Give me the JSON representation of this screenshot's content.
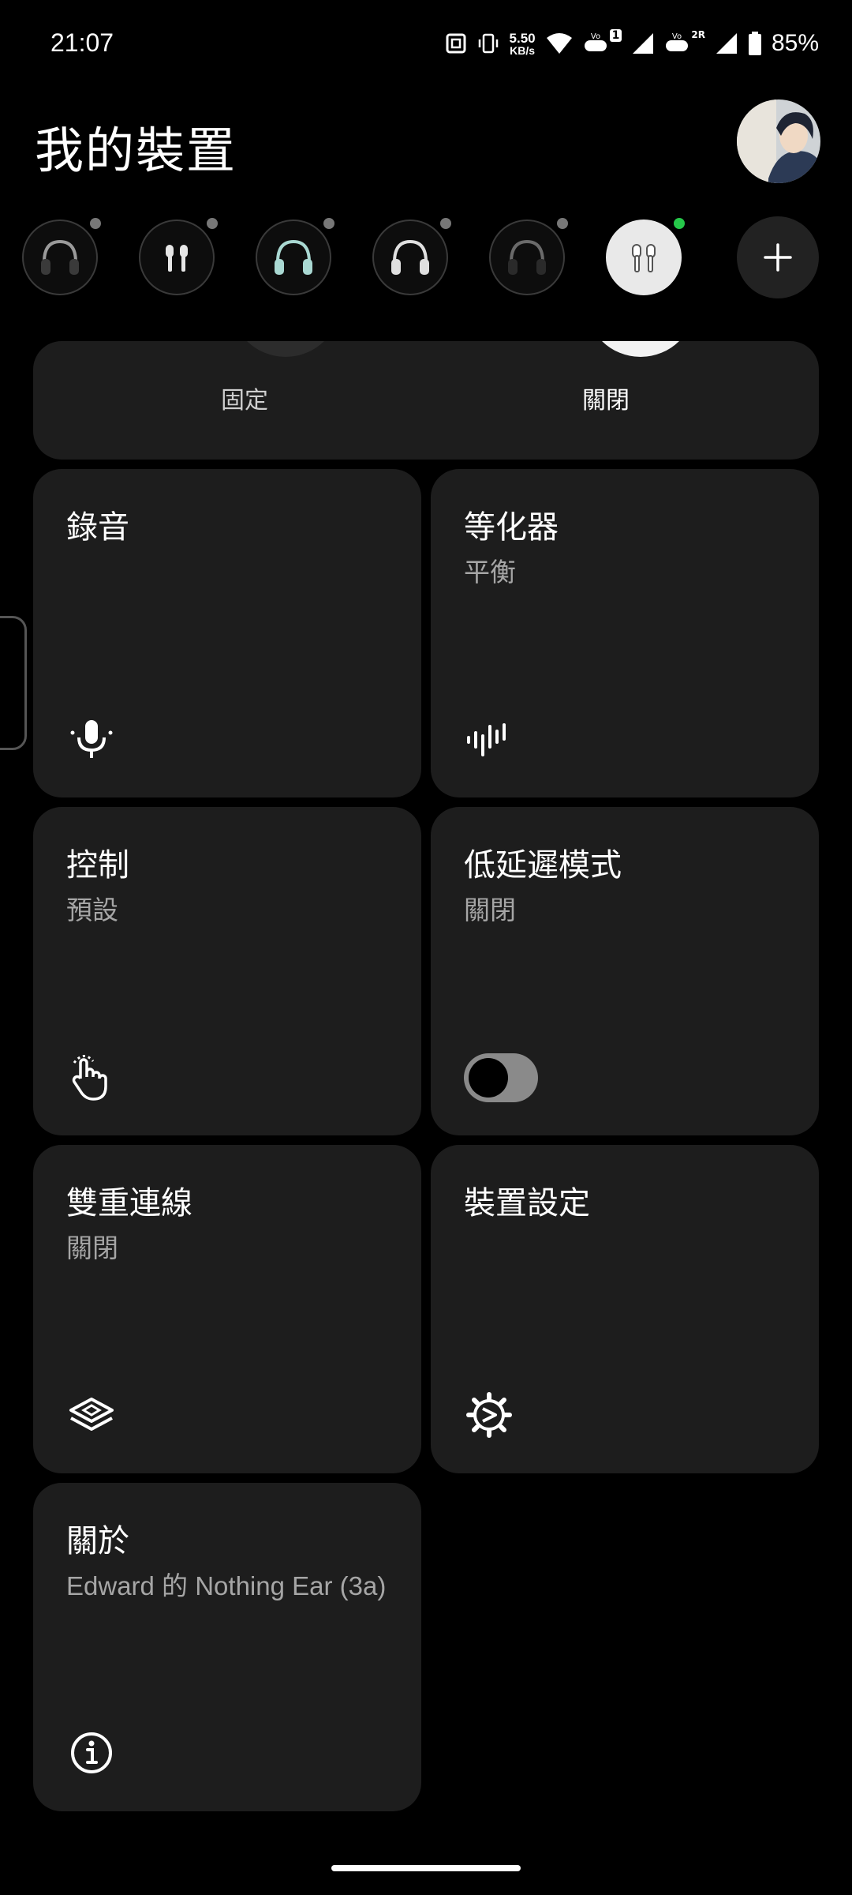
{
  "status_bar": {
    "time": "21:07",
    "speed_value": "5.50",
    "speed_unit": "KB/s",
    "sim1_badge": "1",
    "sim2_badge": "2R",
    "battery": "85%"
  },
  "header": {
    "title": "我的裝置"
  },
  "devices": [
    {
      "icon": "headphones-icon",
      "status": "inactive"
    },
    {
      "icon": "earbuds-icon",
      "status": "inactive"
    },
    {
      "icon": "headphones-mint-icon",
      "status": "inactive"
    },
    {
      "icon": "headphones-white-icon",
      "status": "inactive"
    },
    {
      "icon": "headphones-dark-icon",
      "status": "inactive"
    },
    {
      "icon": "earbuds-icon",
      "status": "connected",
      "selected": true
    }
  ],
  "anc_card": {
    "left_label": "固定",
    "right_label": "關閉"
  },
  "tiles": {
    "recording": {
      "title": "錄音",
      "icon": "microphone-icon"
    },
    "equalizer": {
      "title": "等化器",
      "subtitle": "平衡",
      "icon": "waveform-icon"
    },
    "controls": {
      "title": "控制",
      "subtitle": "預設",
      "icon": "tap-gesture-icon"
    },
    "low_latency": {
      "title": "低延遲模式",
      "subtitle": "關閉",
      "toggle_on": false
    },
    "dual_connection": {
      "title": "雙重連線",
      "subtitle": "關閉",
      "icon": "layers-icon"
    },
    "device_settings": {
      "title": "裝置設定",
      "icon": "gear-icon"
    },
    "about": {
      "title": "關於",
      "subtitle": "Edward 的 Nothing Ear (3a)",
      "icon": "info-icon"
    }
  },
  "colors": {
    "background": "#000000",
    "tile": "#1d1d1d",
    "connected_dot": "#26c84a"
  }
}
